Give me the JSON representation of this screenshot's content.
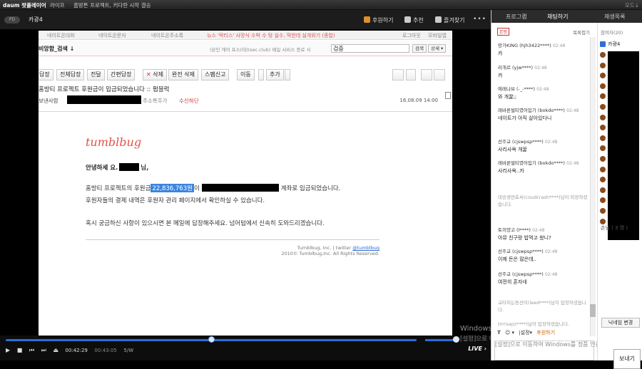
{
  "app": {
    "logo": "daum 팟플레이어",
    "menu": [
      "라이프",
      "홈방튼 프로젝트, 커다란 시작 결승"
    ],
    "window_ctrl": "모드↓"
  },
  "channel": {
    "pill": "PD",
    "title": "카광4",
    "buttons": [
      {
        "label": "후원하기",
        "icon": "coin-icon",
        "color": "#e0902a"
      },
      {
        "label": "추천",
        "icon": "thumb-icon",
        "color": "#cccccc"
      },
      {
        "label": "즐겨찾기",
        "icon": "star-icon",
        "color": "#cccccc"
      }
    ],
    "more": "•••"
  },
  "mail": {
    "top_tabs": [
      "네이트온대화",
      "네이트온문자",
      "네이트온주소록"
    ],
    "top_notice": "뉴스 '락티스' 사망식 수박 수 탕 실수, 딱한데 실개위기 (종합)",
    "top_right": [
      "로그아웃",
      "모바일앱"
    ],
    "box_title": "비앙함_검색 ↓",
    "caption": "(본인 캐어 프스(테)(sec.club) 메일 서비스 종료 사 ",
    "search_value": "검증",
    "search_btn": "검색",
    "detail_btn": "상세 ▾",
    "tools": [
      "답장",
      "전체답장",
      "전달",
      "간편답장",
      "삭제",
      "완전 삭제",
      "스팸신고",
      "이동",
      "추가"
    ],
    "subject": "홈방티 프로젝트 후원금이 입금되었습니다 :: 펌블럭",
    "from_label": "보낸사람",
    "from_add": "주소록추가",
    "from_safe": "수신하단",
    "date": "16.08.09 14:00",
    "brand": "tumblbug",
    "greeting": "안녕하세 요.",
    "greeting_tail": "님,",
    "line1_pre": "홈방티 프로젝트의 후원금",
    "amount": "22,836,763원",
    "line1_mid": "이",
    "line1_post": "계좌로 입금되었습니다.",
    "line2": "후원자들의 결제 내역은 후원자 관리 페이지에서 확인하실 수 있습니다.",
    "line3": "혹시 궁금하신 사항이 있으시면 본 메일에 답장해주세요. 넘어텀에서 신속히 도와드리겠습니다.",
    "footer1_pre": "Tumblbug, Inc. | twitter",
    "footer1_link": "@tumblbug",
    "footer2": "2010© Tumblbug,Inc. All Rights Reserved."
  },
  "player": {
    "progress": 0.5,
    "current": "00:42:29",
    "total": "00:43:05",
    "quality": "5/W",
    "live": "LIVE ›",
    "buttons": [
      "▶",
      "■",
      "⏮",
      "⏭",
      "⏏"
    ]
  },
  "sidebar": {
    "tabs": [
      "프로그램",
      "채팅하기",
      "재생목록"
    ],
    "chat_badge": "본방",
    "chat_fold": "목록접기",
    "messages": [
      {
        "name": "망가KING (hjh3422****)",
        "time": "02:48",
        "text": "카"
      },
      {
        "name": "러개르 (yjw****)",
        "time": "02:48",
        "text": "카"
      },
      {
        "name": "에레나브 (-_-****)",
        "time": "02:48",
        "text": "와 개꿀;;"
      },
      {
        "name": "레바론벌티였어입기 (bokdo****)",
        "time": "02:48",
        "text": "네이트가 아직 살아있다니"
      },
      {
        "name": "선주교 (cjswpsp****)",
        "time": "02:48",
        "text": "사리사욕 개꿀"
      },
      {
        "name": "레바론벌티였어입기 (bokdo****)",
        "time": "02:48",
        "text": "사리사욕..카"
      },
      {
        "name": "",
        "time": "",
        "text": "대승생연포씨(coudcrash****)님이 퇴장하셨습니다."
      },
      {
        "name": "토끼양고 (l****)",
        "time": "02:48",
        "text": "아뮤 친구랑 밥먹고 왔니?"
      },
      {
        "name": "선주교 (cjswpsp****)",
        "time": "02:48",
        "text": "이제 돈은 많은데.."
      },
      {
        "name": "선주교 (cjswpsp****)",
        "time": "02:48",
        "text": "여전히 혼자네"
      },
      {
        "name": "",
        "time": "",
        "text": "교타처는동선이(leed****)님이 입장하셨습니다."
      },
      {
        "name": "",
        "time": "",
        "text": "tm(sapz****)님이 입장하셨습니다."
      }
    ],
    "chat_tools": [
      "T",
      "☺ ▾",
      "|설정▾",
      "후원하기"
    ],
    "input_placeholder": "[설정]으로 이동하여 Windows를 정품 인증합니다.",
    "users_head": "참여자(20)",
    "user_first": "카광4",
    "guests": "손님 ( 3 명 )",
    "nick_btn": "닉네임 변경",
    "send_btn": "보내기"
  },
  "windows_watermark": {
    "line1": "Windows 정품 인증",
    "line2": "[설정]으로 이동하여 Windows를 정품 인증합니다."
  }
}
